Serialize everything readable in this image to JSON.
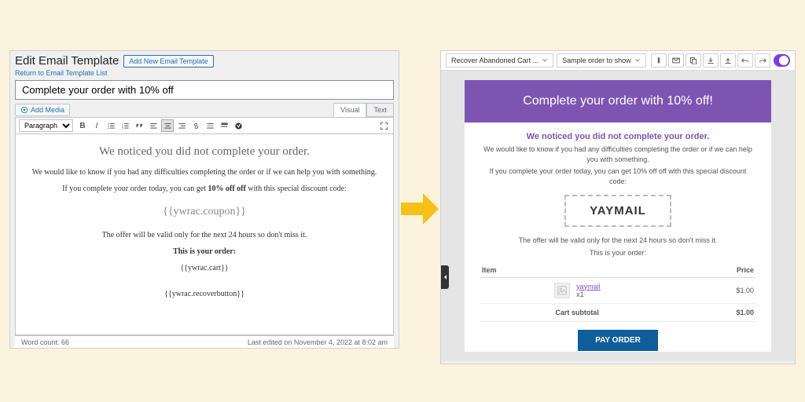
{
  "left": {
    "page_title": "Edit Email Template",
    "add_new_btn": "Add New Email Template",
    "back_link": "Return to Email Template List",
    "title_value": "Complete your order with 10% off",
    "add_media": "Add Media",
    "tabs": {
      "visual": "Visual",
      "text": "Text"
    },
    "format_select": "Paragraph",
    "content": {
      "h2": "We noticed you did not complete your order.",
      "p1": "We would like to know if you had any difficulties completing the order or if we can help you with something.",
      "p2_pre": "If you complete your order today, you can get ",
      "p2_bold": "10% off off",
      "p2_post": " with this special discount code:",
      "coupon": "{{ywrac.coupon}}",
      "p3": "The offer will be valid only for the next 24 hours so don't miss it.",
      "p4": "This is your order:",
      "cart": "{{ywrac.cart}}",
      "recover": "{{ywrac.recoverbutton}}"
    },
    "status": {
      "words": "Word count: 66",
      "edited": "Last edited on November 4, 2022 at 8:02 am"
    }
  },
  "right": {
    "select1": "Recover Abandoned Cart ...",
    "select2": "Sample order to show",
    "email": {
      "header": "Complete your order with 10% off!",
      "h3": "We noticed you did not complete your order.",
      "p1": "We would like to know if you had any difficulties completing the order or if we can help you with something.",
      "p2": "If you complete your order today, you can get 10% off off with this special discount code:",
      "coupon": "YAYMAIL",
      "p3": "The offer will be valid only for the next 24 hours so don't miss it.",
      "p4": "This is your order:",
      "th_item": "Item",
      "th_price": "Price",
      "prod_name": "yaymail",
      "prod_qty": "x1",
      "prod_price": "$1.00",
      "subtotal_label": "Cart subtotal",
      "subtotal_value": "$1.00",
      "pay_btn": "PAY ORDER"
    }
  }
}
